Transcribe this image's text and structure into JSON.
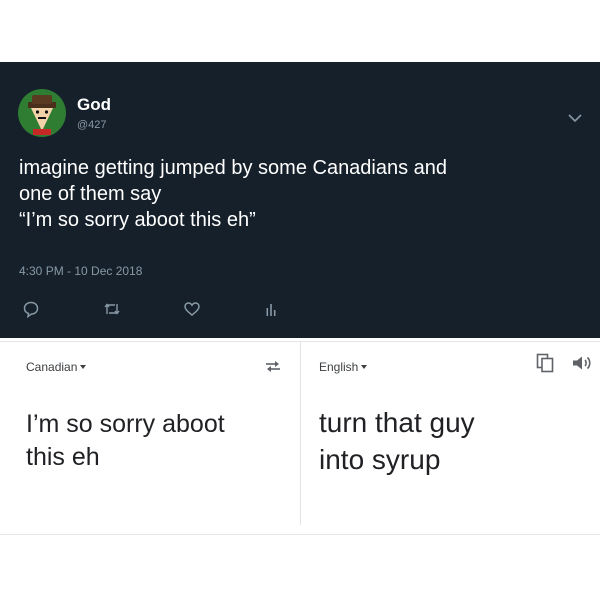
{
  "tweet": {
    "author_name": "God",
    "author_handle": "@427",
    "text_lines": [
      "imagine getting jumped by some Canadians and",
      "one of them say",
      "“I’m so sorry aboot this eh”"
    ],
    "timestamp": "4:30 PM - 10 Dec 2018",
    "icons": [
      "reply-icon",
      "retweet-icon",
      "like-icon",
      "analytics-icon",
      "chevron-down-icon"
    ],
    "colors": {
      "background": "#15202b",
      "muted": "#8899a6",
      "text": "#ffffff"
    }
  },
  "translator": {
    "source_language": "Canadian",
    "target_language": "English",
    "source_text_lines": [
      "I’m so sorry aboot",
      "this eh"
    ],
    "translated_text_lines": [
      "turn that guy",
      "into syrup"
    ],
    "icons": [
      "swap-languages-icon",
      "copy-icon",
      "speaker-icon",
      "caret-down-icon"
    ]
  }
}
